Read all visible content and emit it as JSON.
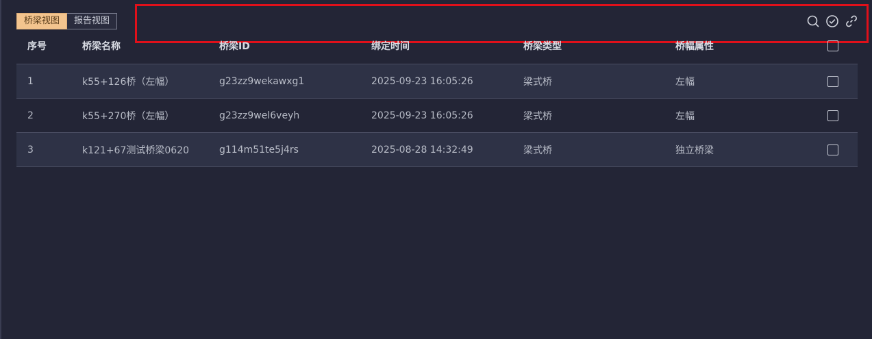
{
  "view_toggle": {
    "bridge_view": "桥梁视图",
    "report_view": "报告视图"
  },
  "toolbar": {
    "icons": [
      "search-icon",
      "check-circle-icon",
      "link-icon"
    ]
  },
  "table": {
    "headers": {
      "index": "序号",
      "name": "桥梁名称",
      "id": "桥梁ID",
      "time": "绑定时间",
      "type": "桥梁类型",
      "attr": "桥幅属性"
    },
    "rows": [
      {
        "index": "1",
        "name": "k55+126桥（左幅）",
        "id": "g23zz9wekawxg1",
        "time": "2025-09-23 16:05:26",
        "type": "梁式桥",
        "attr": "左幅"
      },
      {
        "index": "2",
        "name": "k55+270桥（左幅）",
        "id": "g23zz9wel6veyh",
        "time": "2025-09-23 16:05:26",
        "type": "梁式桥",
        "attr": "左幅"
      },
      {
        "index": "3",
        "name": "k121+67测试桥梁0620",
        "id": "g114m51te5j4rs",
        "time": "2025-08-28 14:32:49",
        "type": "梁式桥",
        "attr": "独立桥梁"
      }
    ]
  },
  "colors": {
    "background": "#232536",
    "active_tab": "#f3c48e",
    "highlight": "#e0101a"
  }
}
